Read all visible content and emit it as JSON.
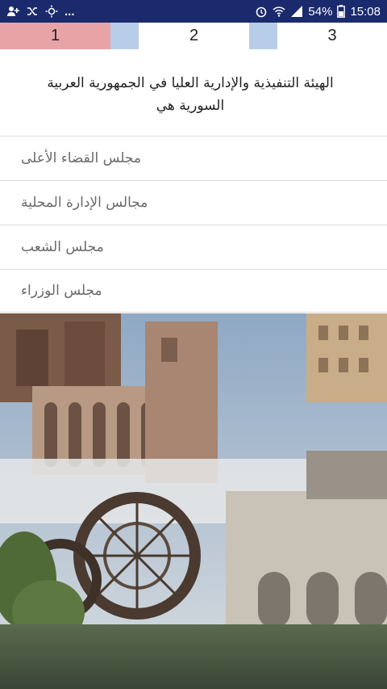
{
  "status_bar": {
    "left_icons": [
      "person-add-icon",
      "shuffle-icon",
      "brightness-icon",
      "more-dots-icon"
    ],
    "dots_text": "...",
    "right_icons": [
      "alarm-icon",
      "wifi-icon",
      "signal-icon",
      "battery-icon"
    ],
    "battery": "54%",
    "time": "15:08"
  },
  "tabs": [
    {
      "label": "1",
      "color": "#e7a3a6"
    },
    {
      "label": "2",
      "color": "#ffffff"
    },
    {
      "label": "3",
      "color": "#ffffff"
    }
  ],
  "separator_color": "#b8cde8",
  "question": "الهيئة التنفيذية والإدارية العليا في الجمهورية العربية السورية هي",
  "answers": [
    "مجلس القضاء الأعلى",
    "مجالس الإدارة المحلية",
    "مجلس الشعب",
    "مجلس الوزراء"
  ]
}
